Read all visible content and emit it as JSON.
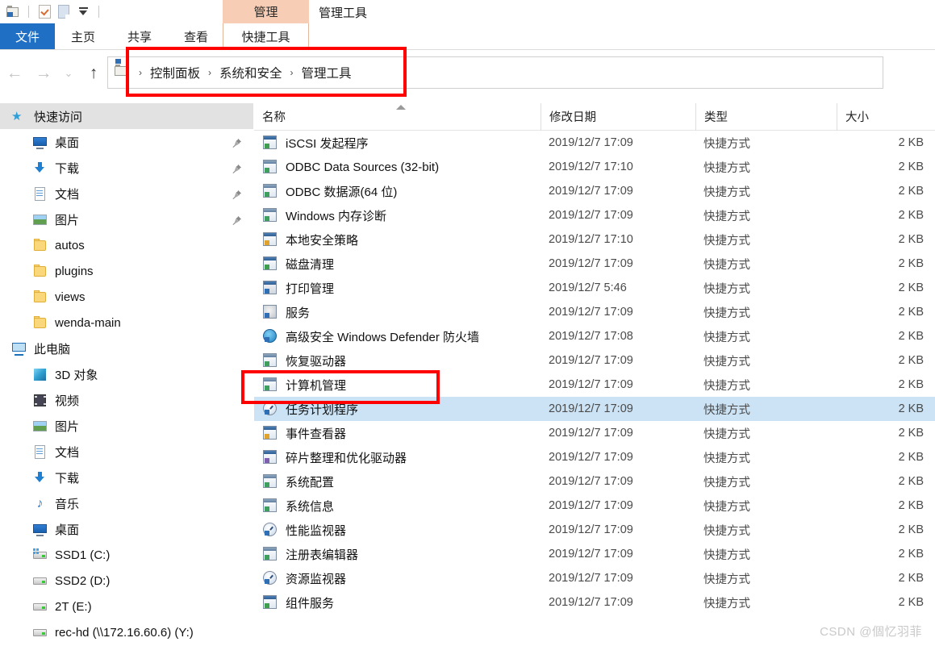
{
  "window": {
    "title": "管理工具",
    "contextual_tab_group": "管理",
    "accent_blue": "#1f6fc4",
    "contextual_peach": "#f8cdb5",
    "selection_blue": "#cce3f5",
    "annotation_red": "#ff0000"
  },
  "quick_access_toolbar": {
    "items": [
      {
        "name": "folder-properties-icon",
        "label": "属性"
      },
      {
        "name": "new-item-icon",
        "label": "新建项目"
      },
      {
        "name": "paste-icon",
        "label": "粘贴"
      },
      {
        "name": "customize-caret-icon",
        "label": "自定义快速访问工具栏"
      }
    ]
  },
  "ribbon": {
    "tabs": [
      {
        "label": "文件",
        "selected": true,
        "style": "file"
      },
      {
        "label": "主页",
        "selected": false,
        "style": "plain"
      },
      {
        "label": "共享",
        "selected": false,
        "style": "plain"
      },
      {
        "label": "查看",
        "selected": false,
        "style": "plain"
      }
    ],
    "contextual_tab": {
      "label": "快捷工具",
      "group": "管理"
    }
  },
  "navbar": {
    "back": "←",
    "forward": "→",
    "recent": "⌄",
    "up": "↑",
    "breadcrumb": {
      "separator": "›",
      "crumbs": [
        "控制面板",
        "系统和安全",
        "管理工具"
      ]
    }
  },
  "sidebar": {
    "sections": [
      {
        "name": "quick-access",
        "header": {
          "label": "快速访问",
          "icon": "star-icon"
        },
        "items": [
          {
            "label": "桌面",
            "icon": "desktop-icon",
            "pinned": true
          },
          {
            "label": "下载",
            "icon": "downloads-icon",
            "pinned": true
          },
          {
            "label": "文档",
            "icon": "documents-icon",
            "pinned": true
          },
          {
            "label": "图片",
            "icon": "pictures-icon",
            "pinned": true
          },
          {
            "label": "autos",
            "icon": "folder-icon",
            "pinned": false
          },
          {
            "label": "plugins",
            "icon": "folder-icon",
            "pinned": false
          },
          {
            "label": "views",
            "icon": "folder-icon",
            "pinned": false
          },
          {
            "label": "wenda-main",
            "icon": "folder-icon",
            "pinned": false
          }
        ]
      },
      {
        "name": "this-pc",
        "header": {
          "label": "此电脑",
          "icon": "this-pc-icon"
        },
        "items": [
          {
            "label": "3D 对象",
            "icon": "3d-objects-icon",
            "pinned": false
          },
          {
            "label": "视频",
            "icon": "videos-icon",
            "pinned": false
          },
          {
            "label": "图片",
            "icon": "pictures-icon",
            "pinned": false
          },
          {
            "label": "文档",
            "icon": "documents-icon",
            "pinned": false
          },
          {
            "label": "下载",
            "icon": "downloads-icon",
            "pinned": false
          },
          {
            "label": "音乐",
            "icon": "music-icon",
            "pinned": false
          },
          {
            "label": "桌面",
            "icon": "desktop-icon",
            "pinned": false
          },
          {
            "label": "SSD1 (C:)",
            "icon": "system-drive-icon",
            "pinned": false
          },
          {
            "label": "SSD2 (D:)",
            "icon": "drive-icon",
            "pinned": false
          },
          {
            "label": "2T (E:)",
            "icon": "drive-icon",
            "pinned": false
          },
          {
            "label": "rec-hd (\\\\172.16.60.6) (Y:)",
            "icon": "network-drive-icon",
            "pinned": false
          }
        ]
      }
    ]
  },
  "file_list": {
    "columns": [
      {
        "key": "name",
        "label": "名称",
        "sorted": true,
        "sort_direction": "asc"
      },
      {
        "key": "date",
        "label": "修改日期",
        "sorted": false
      },
      {
        "key": "type",
        "label": "类型",
        "sorted": false
      },
      {
        "key": "size",
        "label": "大小",
        "sorted": false
      }
    ],
    "rows": [
      {
        "name": "iSCSI 发起程序",
        "date": "2019/12/7 17:09",
        "type": "快捷方式",
        "size": "2 KB",
        "icon": "iscsi-icon",
        "variant": "v-green",
        "selected": false
      },
      {
        "name": "ODBC Data Sources (32-bit)",
        "date": "2019/12/7 17:10",
        "type": "快捷方式",
        "size": "2 KB",
        "icon": "odbc-icon",
        "variant": "v-disk",
        "selected": false
      },
      {
        "name": "ODBC 数据源(64 位)",
        "date": "2019/12/7 17:09",
        "type": "快捷方式",
        "size": "2 KB",
        "icon": "odbc-icon",
        "variant": "v-disk",
        "selected": false
      },
      {
        "name": "Windows 内存诊断",
        "date": "2019/12/7 17:09",
        "type": "快捷方式",
        "size": "2 KB",
        "icon": "memory-diagnostic-icon",
        "variant": "v-disk",
        "selected": false
      },
      {
        "name": "本地安全策略",
        "date": "2019/12/7 17:10",
        "type": "快捷方式",
        "size": "2 KB",
        "icon": "local-security-policy-icon",
        "variant": "v-lock",
        "selected": false
      },
      {
        "name": "磁盘清理",
        "date": "2019/12/7 17:09",
        "type": "快捷方式",
        "size": "2 KB",
        "icon": "disk-cleanup-icon",
        "variant": "v-green",
        "selected": false
      },
      {
        "name": "打印管理",
        "date": "2019/12/7 5:46",
        "type": "快捷方式",
        "size": "2 KB",
        "icon": "print-management-icon",
        "variant": "v-printer",
        "selected": false
      },
      {
        "name": "服务",
        "date": "2019/12/7 17:09",
        "type": "快捷方式",
        "size": "2 KB",
        "icon": "services-icon",
        "variant": "v-gear",
        "selected": false
      },
      {
        "name": "高级安全 Windows Defender 防火墙",
        "date": "2019/12/7 17:08",
        "type": "快捷方式",
        "size": "2 KB",
        "icon": "firewall-icon",
        "variant": "v-globe",
        "selected": false
      },
      {
        "name": "恢复驱动器",
        "date": "2019/12/7 17:09",
        "type": "快捷方式",
        "size": "2 KB",
        "icon": "recovery-drive-icon",
        "variant": "v-disk",
        "selected": false
      },
      {
        "name": "计算机管理",
        "date": "2019/12/7 17:09",
        "type": "快捷方式",
        "size": "2 KB",
        "icon": "computer-management-icon",
        "variant": "v-disk",
        "selected": false
      },
      {
        "name": "任务计划程序",
        "date": "2019/12/7 17:09",
        "type": "快捷方式",
        "size": "2 KB",
        "icon": "task-scheduler-icon",
        "variant": "v-clock",
        "selected": true
      },
      {
        "name": "事件查看器",
        "date": "2019/12/7 17:09",
        "type": "快捷方式",
        "size": "2 KB",
        "icon": "event-viewer-icon",
        "variant": "v-lock",
        "selected": false
      },
      {
        "name": "碎片整理和优化驱动器",
        "date": "2019/12/7 17:09",
        "type": "快捷方式",
        "size": "2 KB",
        "icon": "defragment-icon",
        "variant": "v-purple",
        "selected": false
      },
      {
        "name": "系统配置",
        "date": "2019/12/7 17:09",
        "type": "快捷方式",
        "size": "2 KB",
        "icon": "system-configuration-icon",
        "variant": "v-disk",
        "selected": false
      },
      {
        "name": "系统信息",
        "date": "2019/12/7 17:09",
        "type": "快捷方式",
        "size": "2 KB",
        "icon": "system-information-icon",
        "variant": "v-disk",
        "selected": false
      },
      {
        "name": "性能监视器",
        "date": "2019/12/7 17:09",
        "type": "快捷方式",
        "size": "2 KB",
        "icon": "performance-monitor-icon",
        "variant": "v-clock",
        "selected": false
      },
      {
        "name": "注册表编辑器",
        "date": "2019/12/7 17:09",
        "type": "快捷方式",
        "size": "2 KB",
        "icon": "registry-editor-icon",
        "variant": "v-disk",
        "selected": false
      },
      {
        "name": "资源监视器",
        "date": "2019/12/7 17:09",
        "type": "快捷方式",
        "size": "2 KB",
        "icon": "resource-monitor-icon",
        "variant": "v-clock",
        "selected": false
      },
      {
        "name": "组件服务",
        "date": "2019/12/7 17:09",
        "type": "快捷方式",
        "size": "2 KB",
        "icon": "component-services-icon",
        "variant": "v-green",
        "selected": false
      }
    ]
  },
  "annotations": [
    {
      "name": "breadcrumb-highlight",
      "target": "控制面板 › 系统和安全 › 管理工具"
    },
    {
      "name": "task-scheduler-highlight",
      "target": "任务计划程序"
    }
  ],
  "watermark": "CSDN @個忆羽菲"
}
